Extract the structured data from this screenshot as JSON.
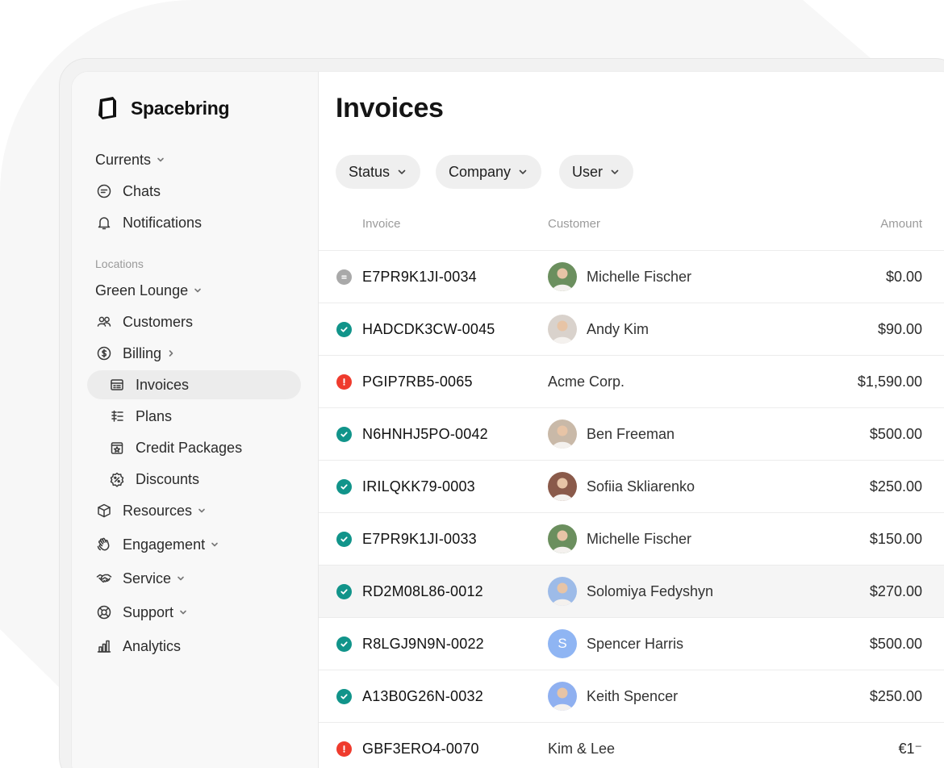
{
  "brand": {
    "name": "Spacebring"
  },
  "colors": {
    "accent_ok": "#11948a",
    "accent_error": "#ef3b2d",
    "neutral_status": "#a9a9a9",
    "active_bg": "#ececec"
  },
  "sidebar": {
    "currents_label": "Currents",
    "chats_label": "Chats",
    "notifications_label": "Notifications",
    "locations_section": "Locations",
    "location_selected": "Green Lounge",
    "customers_label": "Customers",
    "billing_label": "Billing",
    "invoices_label": "Invoices",
    "plans_label": "Plans",
    "credit_packages_label": "Credit Packages",
    "discounts_label": "Discounts",
    "resources_label": "Resources",
    "engagement_label": "Engagement",
    "service_label": "Service",
    "support_label": "Support",
    "analytics_label": "Analytics"
  },
  "main": {
    "title": "Invoices",
    "filters": [
      "Status",
      "Company",
      "User"
    ],
    "columns": {
      "invoice": "Invoice",
      "customer": "Customer",
      "amount": "Amount"
    },
    "rows": [
      {
        "status": "neutral",
        "invoice": "E7PR9K1JI-0034",
        "customer": "Michelle Fischer",
        "avatar": "photo",
        "amount": "$0.00"
      },
      {
        "status": "paid",
        "invoice": "HADCDK3CW-0045",
        "customer": "Andy Kim",
        "avatar": "photo",
        "amount": "$90.00"
      },
      {
        "status": "overdue",
        "invoice": "PGIP7RB5-0065",
        "customer": "Acme Corp.",
        "avatar": "none",
        "amount": "$1,590.00"
      },
      {
        "status": "paid",
        "invoice": "N6HNHJ5PO-0042",
        "customer": "Ben Freeman",
        "avatar": "photo",
        "amount": "$500.00"
      },
      {
        "status": "paid",
        "invoice": "IRILQKK79-0003",
        "customer": "Sofiia Skliarenko",
        "avatar": "photo",
        "amount": "$250.00"
      },
      {
        "status": "paid",
        "invoice": "E7PR9K1JI-0033",
        "customer": "Michelle Fischer",
        "avatar": "photo",
        "amount": "$150.00"
      },
      {
        "status": "paid",
        "invoice": "RD2M08L86-0012",
        "customer": "Solomiya Fedyshyn",
        "avatar": "photo",
        "amount": "$270.00"
      },
      {
        "status": "paid",
        "invoice": "R8LGJ9N9N-0022",
        "customer": "Spencer Harris",
        "avatar": "initial",
        "initial": "S",
        "amount": "$500.00"
      },
      {
        "status": "paid",
        "invoice": "A13B0G26N-0032",
        "customer": "Keith Spencer",
        "avatar": "photo",
        "amount": "$250.00"
      },
      {
        "status": "overdue",
        "invoice": "GBF3ERO4-0070",
        "customer": "Kim & Lee",
        "avatar": "none",
        "amount": "€1⁻"
      }
    ]
  }
}
